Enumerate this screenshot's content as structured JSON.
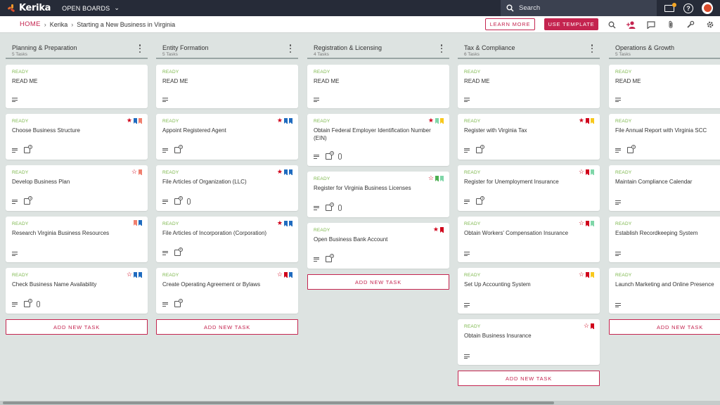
{
  "app": {
    "name": "Kerika",
    "boards_menu": "OPEN BOARDS",
    "search_placeholder": "Search"
  },
  "breadcrumb": {
    "home": "HOME",
    "org": "Kerika",
    "board": "Starting a New Business in Virginia"
  },
  "toolbar": {
    "learn_more": "LEARN MORE",
    "use_template": "USE TEMPLATE"
  },
  "colors": {
    "accent": "#c4244f",
    "ready": "#7ab648",
    "topbar": "#262b38",
    "flag_blue": "#1f6bbf",
    "flag_salmon": "#f07f6e",
    "flag_red": "#d0021b",
    "flag_yellow": "#f8c81c",
    "flag_green": "#4caf50",
    "flag_mint": "#7fd6a8"
  },
  "columns": [
    {
      "title": "Planning & Preparation",
      "count": "5 Tasks",
      "add_label": "ADD NEW TASK",
      "cards": [
        {
          "status": "READY",
          "title": "READ ME",
          "height": 62,
          "star": "",
          "flags": [],
          "check": "",
          "clip": false
        },
        {
          "status": "READY",
          "title": "Choose Business Structure",
          "height": 65,
          "star": "filled",
          "flags": [
            "flag_blue",
            "flag_salmon"
          ],
          "check": "4",
          "clip": false
        },
        {
          "status": "READY",
          "title": "Develop Business Plan",
          "height": 65,
          "star": "outline",
          "flags": [
            "flag_salmon"
          ],
          "check": "4",
          "clip": false
        },
        {
          "status": "READY",
          "title": "Research Virginia Business Resources",
          "height": 65,
          "star": "",
          "flags": [
            "flag_salmon",
            "flag_blue"
          ],
          "check": "",
          "clip": false
        },
        {
          "status": "READY",
          "title": "Check Business Name Availability",
          "height": 65,
          "star": "outline",
          "flags": [
            "flag_blue",
            "flag_blue"
          ],
          "check": "4",
          "clip": true
        }
      ]
    },
    {
      "title": "Entity Formation",
      "count": "5 Tasks",
      "add_label": "ADD NEW TASK",
      "cards": [
        {
          "status": "READY",
          "title": "READ ME",
          "height": 62,
          "star": "",
          "flags": [],
          "check": "",
          "clip": false
        },
        {
          "status": "READY",
          "title": "Appoint Registered Agent",
          "height": 65,
          "star": "filled",
          "flags": [
            "flag_blue",
            "flag_blue"
          ],
          "check": "4",
          "clip": false
        },
        {
          "status": "READY",
          "title": "File Articles of Organization (LLC)",
          "height": 65,
          "star": "filled",
          "flags": [
            "flag_blue",
            "flag_blue"
          ],
          "check": "5",
          "clip": true
        },
        {
          "status": "READY",
          "title": "File Articles of Incorporation (Corporation)",
          "height": 65,
          "star": "filled",
          "flags": [
            "flag_blue",
            "flag_blue"
          ],
          "check": "5",
          "clip": false
        },
        {
          "status": "READY",
          "title": "Create Operating Agreement or Bylaws",
          "height": 65,
          "star": "outline",
          "flags": [
            "flag_red",
            "flag_blue"
          ],
          "check": "4",
          "clip": false
        }
      ]
    },
    {
      "title": "Registration & Licensing",
      "count": "4 Tasks",
      "add_label": "ADD NEW TASK",
      "cards": [
        {
          "status": "READY",
          "title": "READ ME",
          "height": 62,
          "star": "",
          "flags": [],
          "check": "",
          "clip": false
        },
        {
          "status": "READY",
          "title": "Obtain Federal Employer Identification Number (EIN)",
          "height": 74,
          "star": "filled",
          "flags": [
            "flag_mint",
            "flag_yellow"
          ],
          "check": "4",
          "clip": true
        },
        {
          "status": "READY",
          "title": "Register for Virginia Business Licenses",
          "height": 65,
          "star": "outline",
          "flags": [
            "flag_green",
            "flag_mint"
          ],
          "check": "4",
          "clip": true
        },
        {
          "status": "READY",
          "title": "Open Business Bank Account",
          "height": 65,
          "star": "filled",
          "flags": [
            "flag_red"
          ],
          "check": "4",
          "clip": false
        }
      ]
    },
    {
      "title": "Tax & Compliance",
      "count": "6 Tasks",
      "add_label": "ADD NEW TASK",
      "cards": [
        {
          "status": "READY",
          "title": "READ ME",
          "height": 62,
          "star": "",
          "flags": [],
          "check": "",
          "clip": false
        },
        {
          "status": "READY",
          "title": "Register with Virginia Tax",
          "height": 65,
          "star": "filled",
          "flags": [
            "flag_red",
            "flag_yellow"
          ],
          "check": "4",
          "clip": false
        },
        {
          "status": "READY",
          "title": "Register for Unemployment Insurance",
          "height": 65,
          "star": "outline",
          "flags": [
            "flag_red",
            "flag_mint"
          ],
          "check": "3",
          "clip": false
        },
        {
          "status": "READY",
          "title": "Obtain Workers' Compensation Insurance",
          "height": 65,
          "star": "outline",
          "flags": [
            "flag_red",
            "flag_mint"
          ],
          "check": "",
          "clip": false
        },
        {
          "status": "READY",
          "title": "Set Up Accounting System",
          "height": 65,
          "star": "outline",
          "flags": [
            "flag_red",
            "flag_yellow"
          ],
          "check": "",
          "clip": false
        },
        {
          "status": "READY",
          "title": "Obtain Business Insurance",
          "height": 65,
          "star": "outline",
          "flags": [
            "flag_red"
          ],
          "check": "",
          "clip": false
        }
      ]
    },
    {
      "title": "Operations & Growth",
      "count": "5 Tasks",
      "add_label": "ADD NEW TASK",
      "cards": [
        {
          "status": "READY",
          "title": "READ ME",
          "height": 62,
          "star": "",
          "flags": [],
          "check": "",
          "clip": false
        },
        {
          "status": "READY",
          "title": "File Annual Report with Virginia SCC",
          "height": 65,
          "star": "",
          "flags": [],
          "check": "4",
          "clip": false
        },
        {
          "status": "READY",
          "title": "Maintain Compliance Calendar",
          "height": 65,
          "star": "",
          "flags": [],
          "check": "",
          "clip": false
        },
        {
          "status": "READY",
          "title": "Establish Recordkeeping System",
          "height": 65,
          "star": "",
          "flags": [],
          "check": "",
          "clip": false
        },
        {
          "status": "READY",
          "title": "Launch Marketing and Online Presence",
          "height": 65,
          "star": "",
          "flags": [],
          "check": "",
          "clip": false
        }
      ]
    }
  ]
}
